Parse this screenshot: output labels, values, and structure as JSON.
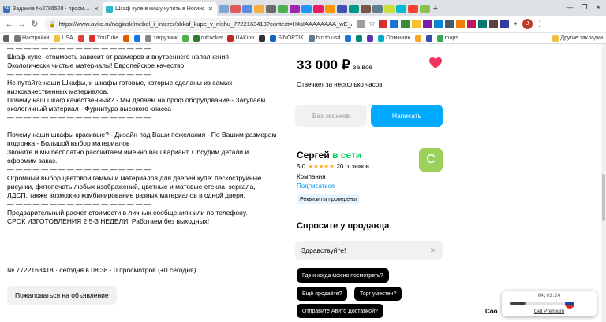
{
  "browser": {
    "tabs": [
      {
        "label": "Задание №2786528 - просмотр з",
        "favicon_text": "SP",
        "favicon_color": "#3d6fb6",
        "active": false
      },
      {
        "label": "Шкаф купе в нишу купить в Ногинс",
        "favicon_color": "#2fb8c9",
        "active": true
      }
    ],
    "new_tab": "+",
    "window_controls": [
      "—",
      "❐",
      "✕"
    ],
    "url": "https://www.avito.ru/noginsk/mebel_i_interer/shkaf_kupe_v_nishu_7722163418?context=H4sIAAAAAAAA_wE_AMD_YToyOntz...",
    "bookmarks": [
      "Настройки",
      "USA",
      "YouTube",
      "загрузчик",
      "rutracker",
      "UAKino",
      "SINOPTIK",
      "btc to usd",
      "Обмінник",
      "maps"
    ],
    "other_bookmarks": "Другие закладки",
    "profile_initial": "J"
  },
  "description": {
    "cutoff_top": "— — — — — — — — — — — — — — — — —",
    "lines": [
      "— — — — — — — — — — — — — — — — —",
      "Шкаф-купе -стоимость зависит от размеров и внутреннего наполнения",
      "Экологически чистые материалы! Европейское качество!",
      "— — — — — — — — — — — — — — — — —",
      "Не путайте наши Шкафы, и шкафы готовые, которые сделаны из самых",
      "низкокачественных материалов.",
      "Почему наш шкаф качественный? - Мы делаем на проф оборудование - Закупаем",
      "экологичный материал - Фурнитура высокого класса",
      "— — — — — — — — — — — — — — — — —",
      "Почему наши шкафы красивые? - Дизайн под Ваши пожелания - По Вашим размерам",
      "подгонка - Большой выбор материалов",
      "Звоните и мы бесплатно рассчитаем именно ваш вариант. Обсудим детали и",
      "оформим заказ.",
      "— — — — — — — — — — — — — — — — —",
      "Огромный выбор цветовой гаммы и материалов для дверей купе: пескоструйные",
      "рисунки, фотопечать любых изображений, цветные и матовые стекла, зеркала,",
      "ЛДСП, также возможно комбинирование разных материалов в одной двери.",
      "— — — — — — — — — — — — — — — — —",
      "Предварительный расчет стоимости в личных сообщениях или по телефону.",
      "СРОК ИЗГОТОВЛЕНИЯ 2,5-3 НЕДЕЛИ. Работаем без выходных!"
    ]
  },
  "ad_meta": "№ 7722163418 · сегодня в 08:38 · 0 просмотров (+0 сегодня)",
  "complain_label": "Пожаловаться на объявление",
  "price": {
    "amount": "33 000 ₽",
    "suffix": "за всё"
  },
  "reply_time": "Отвечает за несколько часов",
  "buttons": {
    "no_calls": "Без звонков",
    "write": "Написать"
  },
  "seller": {
    "name": "Сергей",
    "status": "в сети",
    "avatar_letter": "С",
    "avatar_color": "#9ad15a",
    "rating": "5,0",
    "stars": "★★★★★",
    "reviews": "20 отзывов",
    "type": "Компания",
    "subscribe": "Подписаться",
    "verified": "Реквизиты проверены"
  },
  "ask": {
    "title": "Спросите у продавца",
    "input_value": "Здравствуйте!",
    "chips": [
      "Где и когда можно посмотреть?",
      "Ещё продаёте?",
      "Торг уместен?",
      "Отправите Авито Доставкой?"
    ]
  },
  "vpn": {
    "timer": "04:03:24",
    "premium": "Get Premium",
    "stub": "Coo"
  },
  "colors": {
    "accent": "#00aaff",
    "online": "#02d15c",
    "heart": "#f2335d",
    "stars": "#ffb021"
  }
}
